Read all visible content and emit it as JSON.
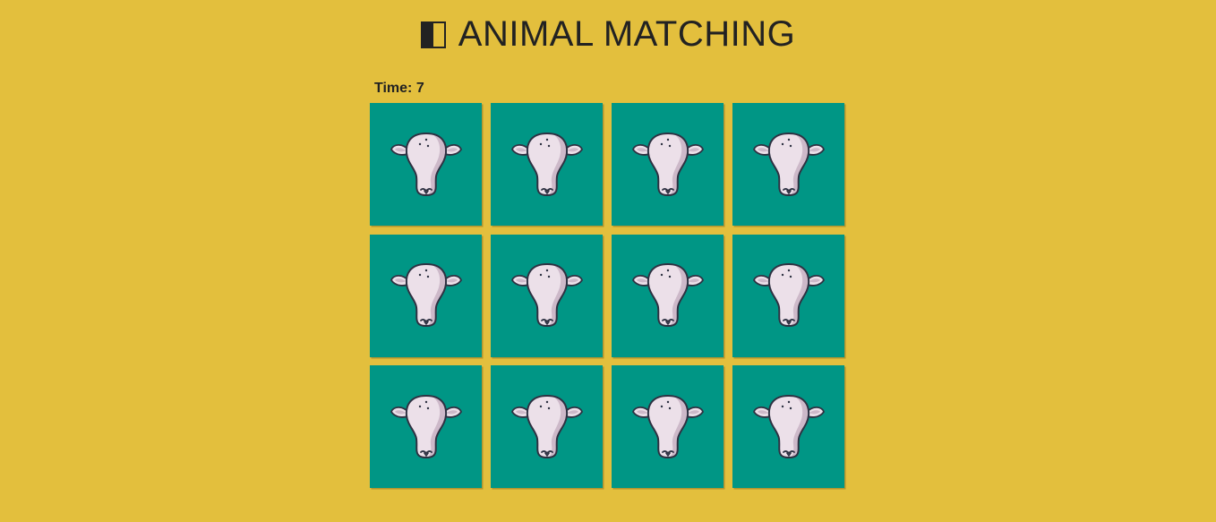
{
  "header": {
    "title": "ANIMAL MATCHING"
  },
  "status": {
    "timer": "Time: 7"
  },
  "board": {
    "card_color": "#009685",
    "background_color": "#e3bf3d",
    "cards": [
      {
        "icon": "cow-icon"
      },
      {
        "icon": "cow-icon"
      },
      {
        "icon": "cow-icon"
      },
      {
        "icon": "cow-icon"
      },
      {
        "icon": "cow-icon"
      },
      {
        "icon": "cow-icon"
      },
      {
        "icon": "cow-icon"
      },
      {
        "icon": "cow-icon"
      },
      {
        "icon": "cow-icon"
      },
      {
        "icon": "cow-icon"
      },
      {
        "icon": "cow-icon"
      },
      {
        "icon": "cow-icon"
      }
    ]
  }
}
